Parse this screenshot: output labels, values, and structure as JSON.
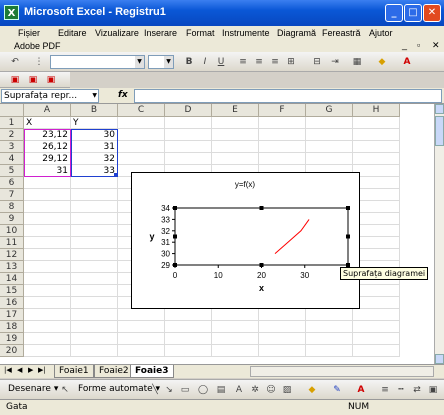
{
  "window": {
    "app_icon": "X",
    "title": "Microsoft Excel - Registru1",
    "min": "_",
    "max": "□",
    "close": "✕"
  },
  "menu": {
    "items": [
      "Fișier",
      "Editare",
      "Vizualizare",
      "Inserare",
      "Format",
      "Instrumente",
      "Diagramă",
      "Fereastră",
      "Ajutor"
    ],
    "pdf": "Adobe PDF",
    "mdi": {
      "min": "_",
      "restore": "▫",
      "close": "✕"
    }
  },
  "formula_bar": {
    "name_box": "Suprafața repr...",
    "fx": "fx",
    "formula": ""
  },
  "columns": [
    "A",
    "B",
    "C",
    "D",
    "E",
    "F",
    "G",
    "H"
  ],
  "rows": [
    "1",
    "2",
    "3",
    "4",
    "5",
    "6",
    "7",
    "8",
    "9",
    "10",
    "11",
    "12",
    "13",
    "14",
    "15",
    "16",
    "17",
    "18",
    "19",
    "20"
  ],
  "cells": [
    {
      "row": 0,
      "col": 0,
      "value": "X",
      "num": false
    },
    {
      "row": 0,
      "col": 1,
      "value": "Y",
      "num": false
    },
    {
      "row": 1,
      "col": 0,
      "value": "23,12",
      "num": true
    },
    {
      "row": 1,
      "col": 1,
      "value": "30",
      "num": true
    },
    {
      "row": 2,
      "col": 0,
      "value": "26,12",
      "num": true
    },
    {
      "row": 2,
      "col": 1,
      "value": "31",
      "num": true
    },
    {
      "row": 3,
      "col": 0,
      "value": "29,12",
      "num": true
    },
    {
      "row": 3,
      "col": 1,
      "value": "32",
      "num": true
    },
    {
      "row": 4,
      "col": 0,
      "value": "31",
      "num": true
    },
    {
      "row": 4,
      "col": 1,
      "value": "33",
      "num": true
    }
  ],
  "chart_data": {
    "type": "line",
    "title": "y=f(x)",
    "xlabel": "x",
    "ylabel": "y",
    "xlim": [
      0,
      40
    ],
    "ylim": [
      29,
      34
    ],
    "x_ticks": [
      "0",
      "10",
      "20",
      "30"
    ],
    "y_ticks": [
      "34",
      "33",
      "32",
      "31",
      "30",
      "29"
    ],
    "series": [
      {
        "x": [
          23.12,
          26.12,
          29.12,
          31
        ],
        "values": [
          30,
          31,
          32,
          33
        ],
        "color": "#ff0000"
      }
    ]
  },
  "tooltip": "Suprafața diagramei",
  "sheet_tabs": [
    "Foaie1",
    "Foaie2",
    "Foaie3"
  ],
  "active_sheet": 2,
  "draw_toolbar": {
    "desenare": "Desenare ▾",
    "forme": "Forme automate ▾"
  },
  "status": {
    "left": "Gata",
    "num": "NUM"
  }
}
